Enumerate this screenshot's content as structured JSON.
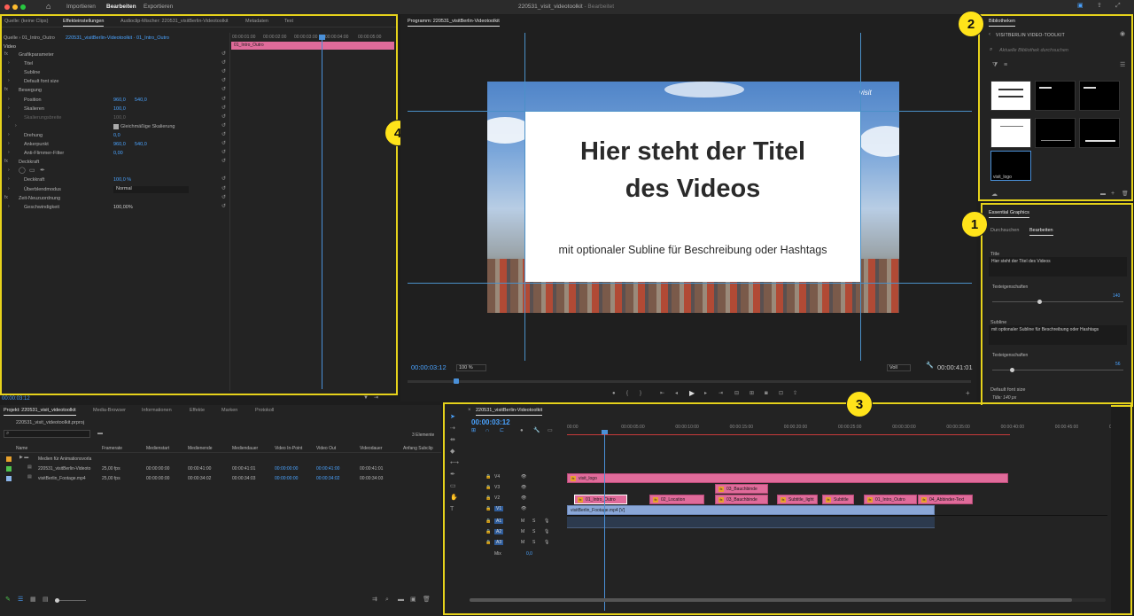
{
  "app": {
    "menu": [
      "Importieren",
      "Bearbeiten",
      "Exportieren"
    ],
    "active_menu": "Bearbeiten",
    "title": "220531_visit_videotoolkit",
    "title_suffix": " - Bearbeitet"
  },
  "effects_panel": {
    "tabs": [
      "Quelle: (keine Clips)",
      "Effekteinstellungen",
      "Audioclip-Mischer: 220531_visitBerlin-Videotoolkit",
      "Metadaten",
      "Text"
    ],
    "source_label": "Quelle › 01_Intro_Outro",
    "sequence_label": "220531_visitBerlin-Videotoolkit · 01_Intro_Outro",
    "ruler": [
      "00:00:01:00",
      "00:00:02:00",
      "00:00:03:00",
      "00:00:04:00",
      "00:00:05:00"
    ],
    "clip_name": "01_Intro_Outro",
    "section_video": "Video",
    "rows": [
      {
        "label": "Grafikparameter",
        "indent": 1,
        "fx": true
      },
      {
        "label": "Titel",
        "indent": 2
      },
      {
        "label": "Subline",
        "indent": 2
      },
      {
        "label": "Default font size",
        "indent": 2
      },
      {
        "label": "Bewegung",
        "indent": 1,
        "fx": true
      },
      {
        "label": "Position",
        "indent": 2,
        "v1": "960,0",
        "v2": "540,0"
      },
      {
        "label": "Skalieren",
        "indent": 2,
        "v1": "100,0"
      },
      {
        "label": "Skalierungsbreite",
        "indent": 2,
        "v1": "100,0",
        "dim": true
      },
      {
        "label": "Gleichmäßige Skalierung",
        "indent": 4,
        "check": true
      },
      {
        "label": "Drehung",
        "indent": 2,
        "v1": "0,0"
      },
      {
        "label": "Ankerpunkt",
        "indent": 2,
        "v1": "960,0",
        "v2": "540,0"
      },
      {
        "label": "Anti-Flimmer-Filter",
        "indent": 2,
        "v1": "0,00"
      },
      {
        "label": "Deckkraft",
        "indent": 1,
        "fx": true
      },
      {
        "label": "",
        "indent": 2,
        "shapes": true
      },
      {
        "label": "Deckkraft",
        "indent": 2,
        "v1": "100,0 %"
      },
      {
        "label": "Überblendmodus",
        "indent": 2,
        "select": "Normal"
      },
      {
        "label": "Zeit-Neuzuordnung",
        "indent": 1,
        "fx": true
      },
      {
        "label": "Geschwindigkeit",
        "indent": 2,
        "v1": "100,00%",
        "white": true
      }
    ],
    "timecode": "00:00:03:12"
  },
  "program": {
    "title": "Programm: 220531_visitBerlin-Videotoolkit",
    "video_title_line1": "Hier steht der Titel",
    "video_title_line2": "des Videos",
    "video_subline": "mit optionaler Subline für Beschreibung oder Hashtags",
    "logo": "visit",
    "timecode": "00:00:03:12",
    "zoom": "100 %",
    "quality": "Voll",
    "duration": "00:00:41:01"
  },
  "libraries": {
    "title": "Bibliotheken",
    "library_name": "VISITBERLIN VIDEO-TOOLKIT",
    "search_placeholder": "Aktuelle Bibliothek durchsuchen",
    "selected_item": "visit_logo"
  },
  "essential_graphics": {
    "title": "Essential Graphics",
    "tabs": [
      "Durchsuchen",
      "Bearbeiten"
    ],
    "title_label": "Title",
    "title_value": "Hier steht der Titel des Videos",
    "text_props": "Texteigenschaften",
    "title_size": "140",
    "subline_label": "Subline",
    "subline_value": "mit optionaler Subline für Beschreibung oder Hashtags",
    "subline_size": "56",
    "font_label": "Default font size",
    "font_value": "Title: 140 px"
  },
  "project": {
    "tabs": [
      "Projekt: 220531_visit_videotoolkit",
      "Media-Browser",
      "Informationen",
      "Effekte",
      "Marken",
      "Protokoll"
    ],
    "file": "220531_visit_videotoolkit.prproj",
    "count": "3 Elemente",
    "columns": [
      "Name",
      "Framerate",
      "Medienstart",
      "Medienende",
      "Mediendauer",
      "Video In-Point",
      "Video Out",
      "Videodauer",
      "Anfang Subclip"
    ],
    "items": [
      {
        "color": "#e8a12c",
        "name": "Medien für Animationsvorla",
        "cells": [
          "",
          "",
          "",
          "",
          "",
          "",
          "",
          ""
        ],
        "folder": true
      },
      {
        "color": "#4fc34f",
        "name": "220531_visitBerlin-Videoto",
        "cells": [
          "25,00 fps",
          "00:00:00:00",
          "00:00:41:00",
          "00:00:41:01",
          "00:00:00:00",
          "00:00:41:00",
          "00:00:41:01",
          ""
        ]
      },
      {
        "color": "#8ab4e8",
        "name": "visitBerlin_Footage.mp4",
        "cells": [
          "25,00 fps",
          "00:00:00:00",
          "00:00:34:02",
          "00:00:34:03",
          "00:00:00:00",
          "00:00:34:02",
          "00:00:34:03",
          ""
        ]
      }
    ]
  },
  "timeline": {
    "title": "220531_visitBerlin-Videotoolkit",
    "timecode": "00:00:03:12",
    "ruler": [
      "00:00",
      "00:00:05:00",
      "00:00:10:00",
      "00:00:15:00",
      "00:00:20:00",
      "00:00:25:00",
      "00:00:30:00",
      "00:00:35:00",
      "00:00:40:00",
      "00:00:45:00",
      "00:0"
    ],
    "tracks": [
      "V4",
      "V3",
      "V2",
      "V1",
      "A1",
      "A2",
      "A3",
      "Mix"
    ],
    "mix_value": "0,0",
    "clips_v4": [
      {
        "name": "visit_logo"
      }
    ],
    "clips_v3": [
      {
        "name": "03_Bauchbinde"
      }
    ],
    "clips_v2": [
      {
        "name": "01_Intro_Outro"
      },
      {
        "name": "02_Location"
      },
      {
        "name": "03_Bauchbinde"
      },
      {
        "name": "Subtitle_light"
      },
      {
        "name": "Subtitle"
      },
      {
        "name": "01_Intro_Outro"
      },
      {
        "name": "04_Abbinder-Text"
      }
    ],
    "clips_v1": [
      {
        "name": "visitBerlin_Footage.mp4 [V]"
      }
    ]
  },
  "badges": [
    "1",
    "2",
    "3",
    "4"
  ],
  "accent": "#e6d21b"
}
